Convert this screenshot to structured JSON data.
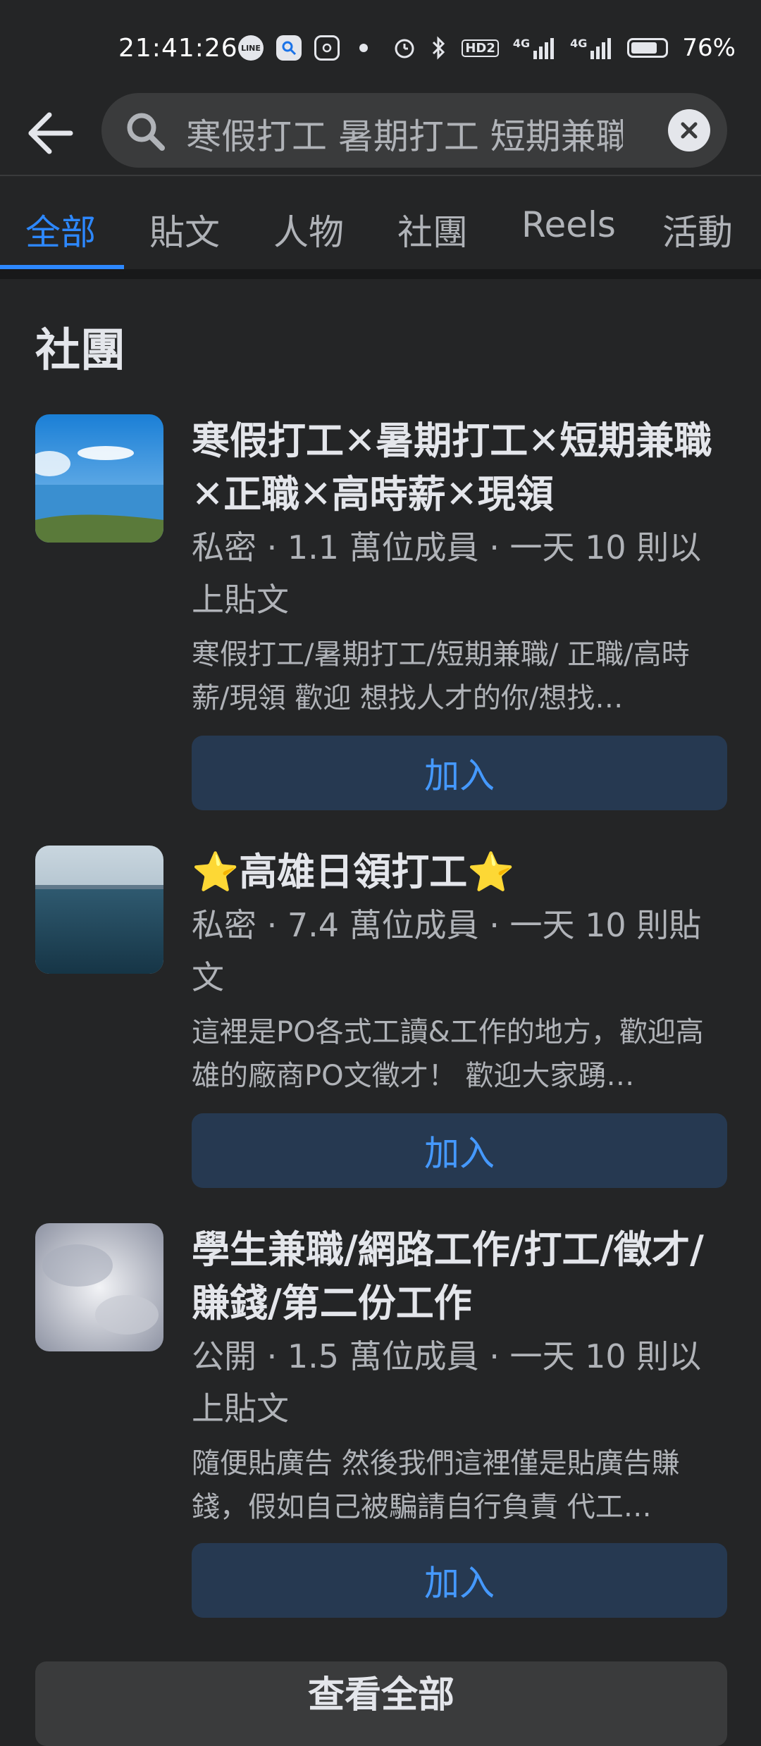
{
  "status_bar": {
    "time": "21:41:26",
    "icons": [
      "line-icon",
      "search-app-icon",
      "instagram-icon",
      "dot-icon",
      "alarm-icon",
      "bluetooth-icon"
    ],
    "hd": "HD2",
    "net1": "4G",
    "net2": "4G",
    "battery": "76%"
  },
  "search": {
    "query": "寒假打工 暑期打工 短期兼職"
  },
  "tabs": [
    {
      "label": "全部",
      "active": true
    },
    {
      "label": "貼文"
    },
    {
      "label": "人物"
    },
    {
      "label": "社團"
    },
    {
      "label": "Reels"
    },
    {
      "label": "活動"
    }
  ],
  "section": {
    "title": "社團",
    "groups": [
      {
        "title": "寒假打工✕暑期打工✕短期兼職✕正職✕高時薪✕現領",
        "meta": "私密 · 1.1 萬位成員 · 一天 10 則以上貼文",
        "description": "寒假打工/暑期打工/短期兼職/ 正職/高時薪/現領 歡迎 想找人才的你/想找…",
        "join_label": "加入"
      },
      {
        "title": "⭐高雄日領打工⭐",
        "meta": "私密 · 7.4 萬位成員 · 一天 10 則貼文",
        "description": "這裡是PO各式工讀&工作的地方，歡迎高雄的廠商PO文徵才！ 歡迎大家踴…",
        "join_label": "加入"
      },
      {
        "title": "學生兼職/網路工作/打工/徵才/賺錢/第二份工作",
        "meta": "公開 · 1.5 萬位成員 · 一天 10 則以上貼文",
        "description": "隨便貼廣告 然後我們這裡僅是貼廣告賺錢，假如自己被騙請自行負責 代工…",
        "join_label": "加入"
      }
    ],
    "see_all_label": "查看全部"
  },
  "colors": {
    "background": "#242526",
    "accent": "#2d88ff",
    "join_bg": "#263951"
  }
}
